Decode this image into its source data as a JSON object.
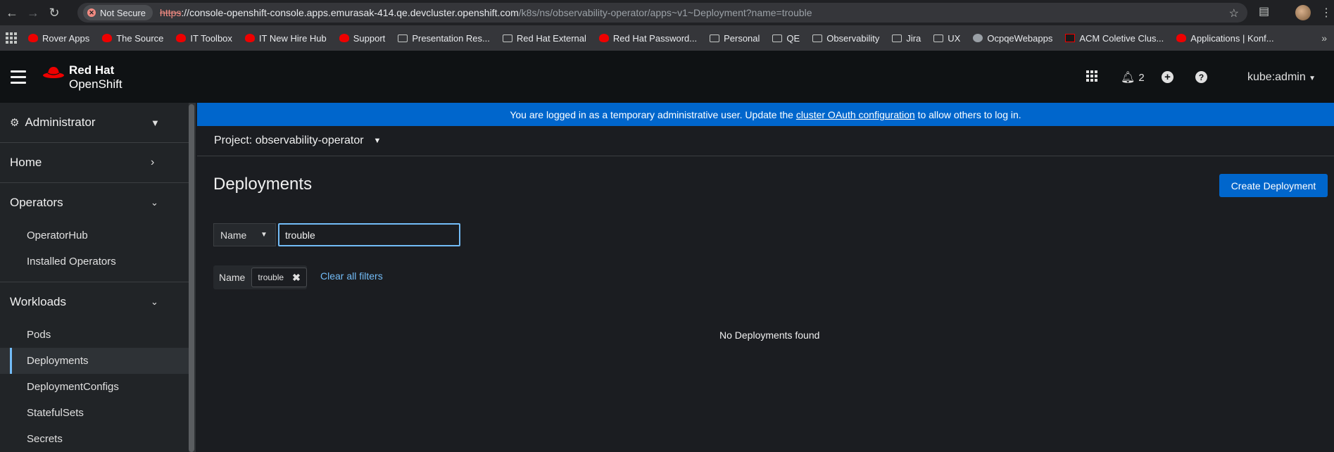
{
  "browser": {
    "security_label": "Not Secure",
    "url_scheme": "https",
    "url_host": "://console-openshift-console.apps.emurasak-414.qe.devcluster.openshift.com",
    "url_path": "/k8s/ns/observability-operator/apps~v1~Deployment?name=trouble",
    "bookmarks": [
      {
        "label": "Rover Apps",
        "icon": "redhat-icon"
      },
      {
        "label": "The Source",
        "icon": "redhat-icon"
      },
      {
        "label": "IT Toolbox",
        "icon": "redhat-icon"
      },
      {
        "label": "IT New Hire Hub",
        "icon": "redhat-icon"
      },
      {
        "label": "Support",
        "icon": "redhat-icon"
      },
      {
        "label": "Presentation Res...",
        "icon": "folder-icon"
      },
      {
        "label": "Red Hat External",
        "icon": "folder-icon"
      },
      {
        "label": "Red Hat Password...",
        "icon": "redhat-icon"
      },
      {
        "label": "Personal",
        "icon": "folder-icon"
      },
      {
        "label": "QE",
        "icon": "folder-icon"
      },
      {
        "label": "Observability",
        "icon": "folder-icon"
      },
      {
        "label": "Jira",
        "icon": "folder-icon"
      },
      {
        "label": "UX",
        "icon": "folder-icon"
      },
      {
        "label": "OcpqeWebapps",
        "icon": "globe-icon"
      },
      {
        "label": "ACM Coletive Clus...",
        "icon": "acm-icon"
      },
      {
        "label": "Applications | Konf...",
        "icon": "redhat-icon"
      }
    ]
  },
  "masthead": {
    "brand_line1": "Red Hat",
    "brand_line2": "OpenShift",
    "notification_count": "2",
    "user": "kube:admin"
  },
  "sidebar": {
    "perspective": "Administrator",
    "sections": [
      {
        "label": "Home",
        "items": []
      },
      {
        "label": "Operators",
        "items": [
          "OperatorHub",
          "Installed Operators"
        ]
      },
      {
        "label": "Workloads",
        "items": [
          "Pods",
          "Deployments",
          "DeploymentConfigs",
          "StatefulSets",
          "Secrets"
        ]
      }
    ],
    "active_item": "Deployments"
  },
  "banner": {
    "text_before": "You are logged in as a temporary administrative user. Update the ",
    "link": "cluster OAuth configuration",
    "text_after": " to allow others to log in."
  },
  "project": {
    "label": "Project: observability-operator"
  },
  "main": {
    "title": "Deployments",
    "create_button": "Create Deployment",
    "filter_type": "Name",
    "filter_value": "trouble",
    "chip_category": "Name",
    "chip_value": "trouble",
    "clear_filters": "Clear all filters",
    "empty_message": "No Deployments found"
  },
  "colors": {
    "accent": "#0066cc",
    "link": "#73bcf7",
    "brand_red": "#ee0000"
  }
}
